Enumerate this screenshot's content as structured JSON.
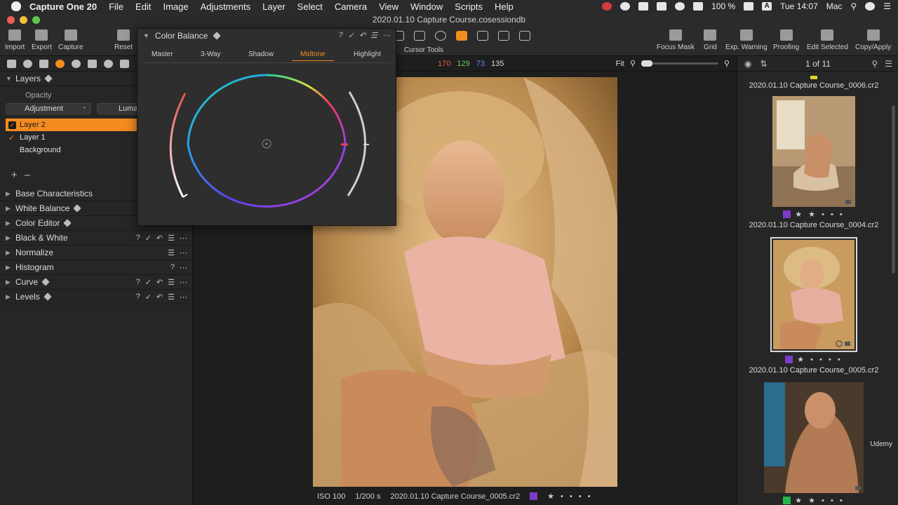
{
  "menubar": {
    "app_name": "Capture One 20",
    "items": [
      "File",
      "Edit",
      "Image",
      "Adjustments",
      "Layer",
      "Select",
      "Camera",
      "View",
      "Window",
      "Scripts",
      "Help"
    ],
    "battery": "100 %",
    "time": "Tue 14:07",
    "user": "Mac",
    "input_letter": "A"
  },
  "window": {
    "title": "2020.01.10 Capture Course.cosessiondb"
  },
  "toolbar": {
    "left": [
      "Import",
      "Export",
      "Capture"
    ],
    "reset": "Reset",
    "cursor_tools": "Cursor Tools",
    "right": [
      "Focus Mask",
      "Grid",
      "Exp. Warning",
      "Proofing",
      "Edit Selected",
      "Copy/Apply"
    ]
  },
  "color_balance": {
    "title": "Color Balance",
    "tabs": [
      "Master",
      "3-Way",
      "Shadow",
      "Midtone",
      "Highlight"
    ],
    "active_tab": "Midtone"
  },
  "layers": {
    "title": "Layers",
    "opacity_label": "Opacity",
    "adjustment_label": "Adjustment",
    "luma_label": "Luma",
    "items": [
      "Layer 2",
      "Layer 1",
      "Background"
    ],
    "selected": "Layer 2"
  },
  "tools": [
    {
      "label": "Base Characteristics"
    },
    {
      "label": "White Balance"
    },
    {
      "label": "Color Editor"
    },
    {
      "label": "Black & White"
    },
    {
      "label": "Normalize"
    },
    {
      "label": "Histogram"
    },
    {
      "label": "Curve"
    },
    {
      "label": "Levels"
    }
  ],
  "viewer": {
    "rgb": {
      "r": "170",
      "g": "129",
      "b": "73",
      "l": "135"
    },
    "zoom_label": "Fit",
    "iso": "ISO 100",
    "shutter": "1/200 s",
    "filename": "2020.01.10 Capture Course_0005.cr2",
    "rating_stars": "★ • • • •"
  },
  "browser": {
    "count": "1 of 11",
    "thumbs": [
      {
        "name": "2020.01.10 Capture Course_0006.cr2",
        "tag": "#e2d32b",
        "rating": ""
      },
      {
        "name": "2020.01.10 Capture Course_0004.cr2",
        "tag": "#7c3cc6",
        "rating": "★ ★ • • •"
      },
      {
        "name": "2020.01.10 Capture Course_0005.cr2",
        "tag": "#7c3cc6",
        "rating": "★ • • • •"
      },
      {
        "name": "",
        "tag": "#27b64a",
        "rating": "★ ★ • • •"
      }
    ],
    "watermark": "Udemy"
  },
  "colors": {
    "accent": "#f28b20",
    "panel": "#262626",
    "toolbar": "#2b2b2b"
  }
}
